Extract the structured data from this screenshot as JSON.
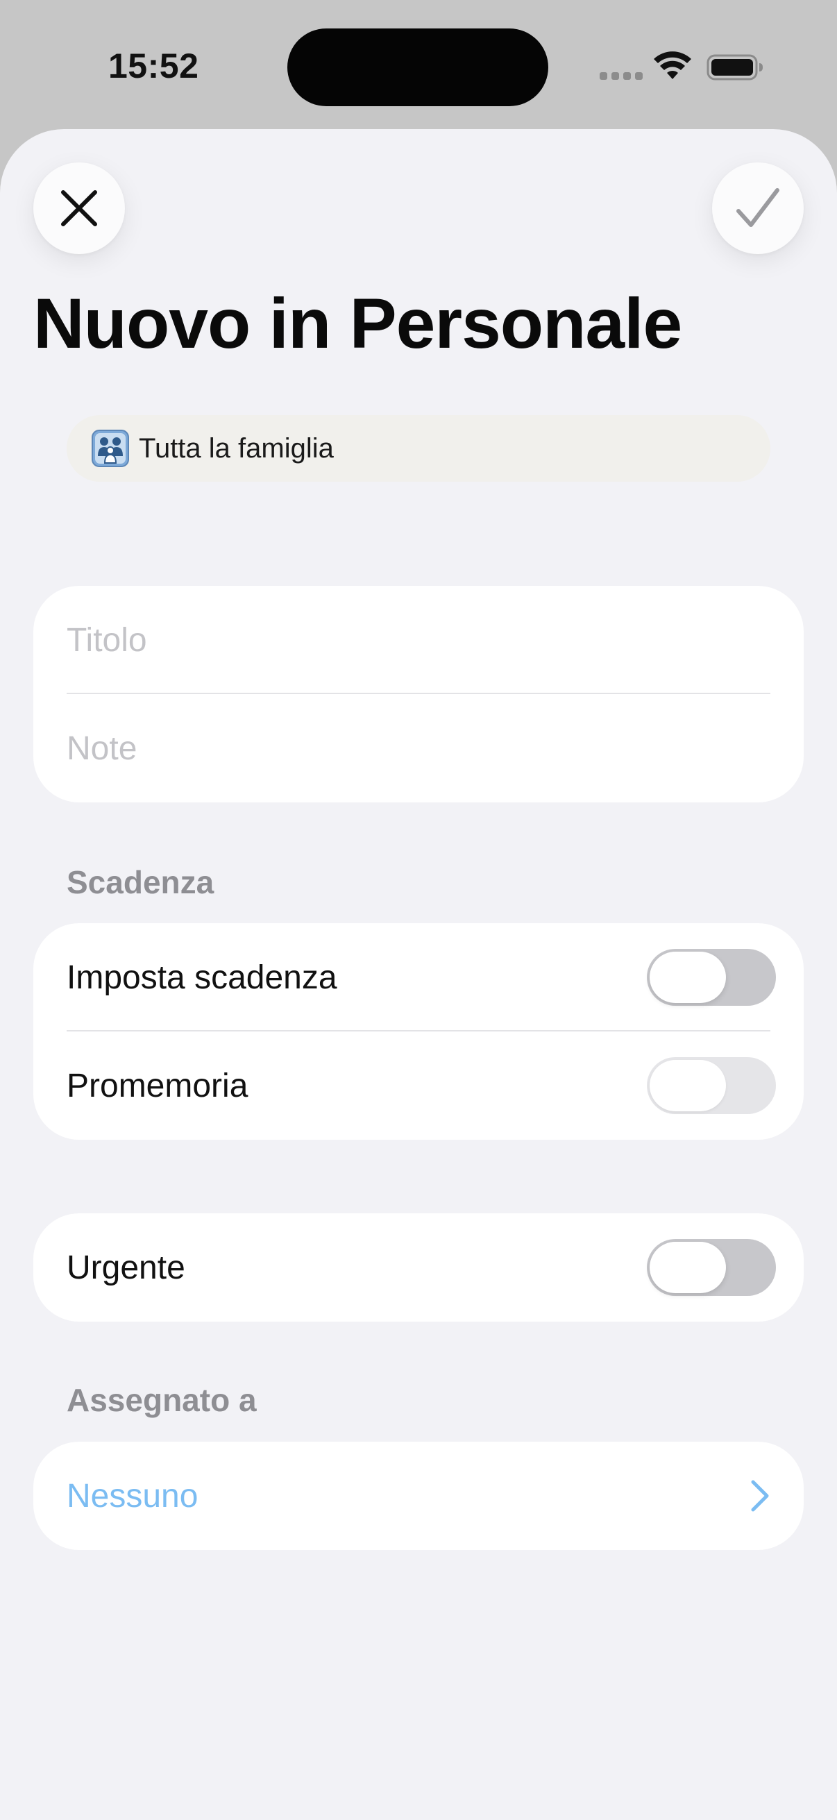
{
  "status_bar": {
    "time": "15:52"
  },
  "header": {
    "title": "Nuovo in Personale",
    "close_icon": "close-icon",
    "confirm_icon": "checkmark-icon"
  },
  "household": {
    "label": "Tutta la famiglia",
    "icon": "family-icon"
  },
  "details": {
    "title_placeholder": "Titolo",
    "title_value": "",
    "notes_placeholder": "Note",
    "notes_value": ""
  },
  "due": {
    "section_title": "Scadenza",
    "set_due_label": "Imposta scadenza",
    "set_due_on": false,
    "reminder_label": "Promemoria",
    "reminder_on": false,
    "reminder_enabled": false
  },
  "priority": {
    "urgent_label": "Urgente",
    "urgent_on": false
  },
  "assignee": {
    "section_title": "Assegnato a",
    "value": "Nessuno",
    "chevron_icon": "chevron-right-icon"
  },
  "colors": {
    "background": "#f2f2f6",
    "card": "#ffffff",
    "accent_link": "#7bbcf2",
    "secondary_text": "#8e8e93",
    "toggle_off": "#c7c7cb"
  }
}
